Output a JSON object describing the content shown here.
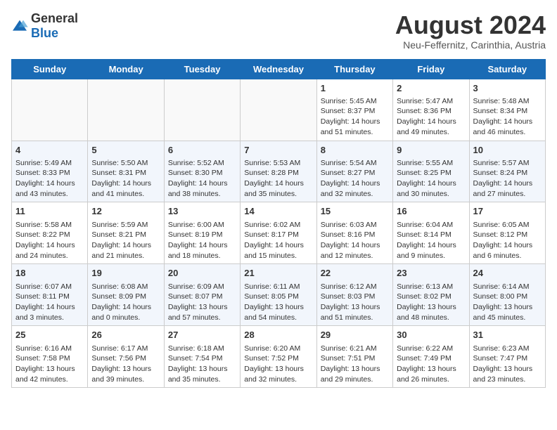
{
  "header": {
    "logo_general": "General",
    "logo_blue": "Blue",
    "title": "August 2024",
    "subtitle": "Neu-Feffernitz, Carinthia, Austria"
  },
  "days_of_week": [
    "Sunday",
    "Monday",
    "Tuesday",
    "Wednesday",
    "Thursday",
    "Friday",
    "Saturday"
  ],
  "weeks": [
    [
      {
        "day": "",
        "info": ""
      },
      {
        "day": "",
        "info": ""
      },
      {
        "day": "",
        "info": ""
      },
      {
        "day": "",
        "info": ""
      },
      {
        "day": "1",
        "info": "Sunrise: 5:45 AM\nSunset: 8:37 PM\nDaylight: 14 hours\nand 51 minutes."
      },
      {
        "day": "2",
        "info": "Sunrise: 5:47 AM\nSunset: 8:36 PM\nDaylight: 14 hours\nand 49 minutes."
      },
      {
        "day": "3",
        "info": "Sunrise: 5:48 AM\nSunset: 8:34 PM\nDaylight: 14 hours\nand 46 minutes."
      }
    ],
    [
      {
        "day": "4",
        "info": "Sunrise: 5:49 AM\nSunset: 8:33 PM\nDaylight: 14 hours\nand 43 minutes."
      },
      {
        "day": "5",
        "info": "Sunrise: 5:50 AM\nSunset: 8:31 PM\nDaylight: 14 hours\nand 41 minutes."
      },
      {
        "day": "6",
        "info": "Sunrise: 5:52 AM\nSunset: 8:30 PM\nDaylight: 14 hours\nand 38 minutes."
      },
      {
        "day": "7",
        "info": "Sunrise: 5:53 AM\nSunset: 8:28 PM\nDaylight: 14 hours\nand 35 minutes."
      },
      {
        "day": "8",
        "info": "Sunrise: 5:54 AM\nSunset: 8:27 PM\nDaylight: 14 hours\nand 32 minutes."
      },
      {
        "day": "9",
        "info": "Sunrise: 5:55 AM\nSunset: 8:25 PM\nDaylight: 14 hours\nand 30 minutes."
      },
      {
        "day": "10",
        "info": "Sunrise: 5:57 AM\nSunset: 8:24 PM\nDaylight: 14 hours\nand 27 minutes."
      }
    ],
    [
      {
        "day": "11",
        "info": "Sunrise: 5:58 AM\nSunset: 8:22 PM\nDaylight: 14 hours\nand 24 minutes."
      },
      {
        "day": "12",
        "info": "Sunrise: 5:59 AM\nSunset: 8:21 PM\nDaylight: 14 hours\nand 21 minutes."
      },
      {
        "day": "13",
        "info": "Sunrise: 6:00 AM\nSunset: 8:19 PM\nDaylight: 14 hours\nand 18 minutes."
      },
      {
        "day": "14",
        "info": "Sunrise: 6:02 AM\nSunset: 8:17 PM\nDaylight: 14 hours\nand 15 minutes."
      },
      {
        "day": "15",
        "info": "Sunrise: 6:03 AM\nSunset: 8:16 PM\nDaylight: 14 hours\nand 12 minutes."
      },
      {
        "day": "16",
        "info": "Sunrise: 6:04 AM\nSunset: 8:14 PM\nDaylight: 14 hours\nand 9 minutes."
      },
      {
        "day": "17",
        "info": "Sunrise: 6:05 AM\nSunset: 8:12 PM\nDaylight: 14 hours\nand 6 minutes."
      }
    ],
    [
      {
        "day": "18",
        "info": "Sunrise: 6:07 AM\nSunset: 8:11 PM\nDaylight: 14 hours\nand 3 minutes."
      },
      {
        "day": "19",
        "info": "Sunrise: 6:08 AM\nSunset: 8:09 PM\nDaylight: 14 hours\nand 0 minutes."
      },
      {
        "day": "20",
        "info": "Sunrise: 6:09 AM\nSunset: 8:07 PM\nDaylight: 13 hours\nand 57 minutes."
      },
      {
        "day": "21",
        "info": "Sunrise: 6:11 AM\nSunset: 8:05 PM\nDaylight: 13 hours\nand 54 minutes."
      },
      {
        "day": "22",
        "info": "Sunrise: 6:12 AM\nSunset: 8:03 PM\nDaylight: 13 hours\nand 51 minutes."
      },
      {
        "day": "23",
        "info": "Sunrise: 6:13 AM\nSunset: 8:02 PM\nDaylight: 13 hours\nand 48 minutes."
      },
      {
        "day": "24",
        "info": "Sunrise: 6:14 AM\nSunset: 8:00 PM\nDaylight: 13 hours\nand 45 minutes."
      }
    ],
    [
      {
        "day": "25",
        "info": "Sunrise: 6:16 AM\nSunset: 7:58 PM\nDaylight: 13 hours\nand 42 minutes."
      },
      {
        "day": "26",
        "info": "Sunrise: 6:17 AM\nSunset: 7:56 PM\nDaylight: 13 hours\nand 39 minutes."
      },
      {
        "day": "27",
        "info": "Sunrise: 6:18 AM\nSunset: 7:54 PM\nDaylight: 13 hours\nand 35 minutes."
      },
      {
        "day": "28",
        "info": "Sunrise: 6:20 AM\nSunset: 7:52 PM\nDaylight: 13 hours\nand 32 minutes."
      },
      {
        "day": "29",
        "info": "Sunrise: 6:21 AM\nSunset: 7:51 PM\nDaylight: 13 hours\nand 29 minutes."
      },
      {
        "day": "30",
        "info": "Sunrise: 6:22 AM\nSunset: 7:49 PM\nDaylight: 13 hours\nand 26 minutes."
      },
      {
        "day": "31",
        "info": "Sunrise: 6:23 AM\nSunset: 7:47 PM\nDaylight: 13 hours\nand 23 minutes."
      }
    ]
  ]
}
